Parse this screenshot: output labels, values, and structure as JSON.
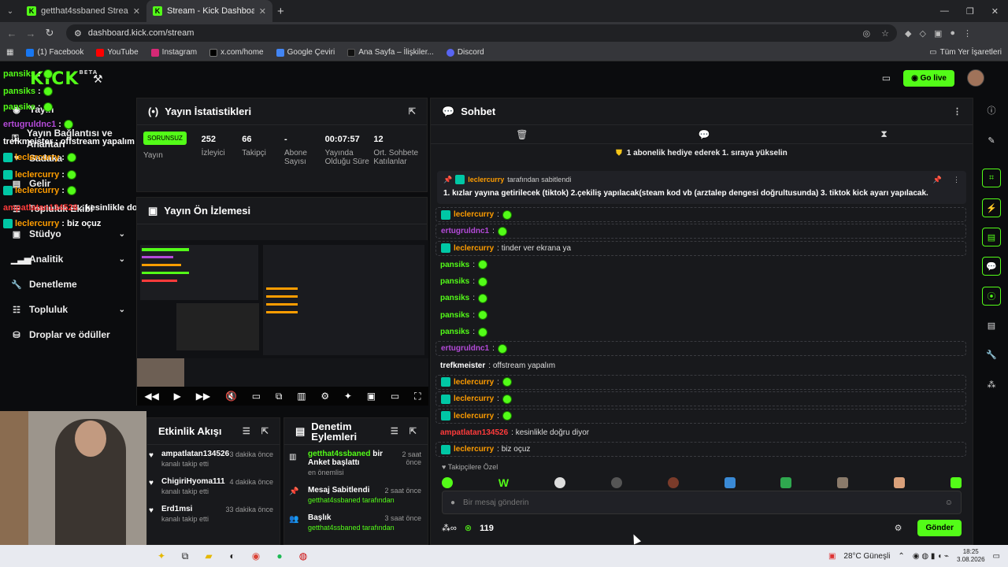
{
  "browser": {
    "tabs": [
      {
        "label": "getthat4ssbaned Stream - Watc"
      },
      {
        "label": "Stream - Kick Dashboard"
      }
    ],
    "url": "dashboard.kick.com/stream",
    "bookmarks": [
      "(1) Facebook",
      "YouTube",
      "Instagram",
      "x.com/home",
      "Google Çeviri",
      "Ana Sayfa – İlişkiler...",
      "Discord"
    ],
    "bookmarks_right": "Tüm Yer İşaretleri"
  },
  "header": {
    "logo": "KICK",
    "beta": "BETA",
    "go_live": "Go live"
  },
  "sidebar": {
    "items": [
      {
        "label": "Yayın",
        "icon": "broadcast-icon"
      },
      {
        "label": "Yayın Bağlantısı ve Anahtarı",
        "icon": "key-icon"
      },
      {
        "label": "Sadaka",
        "icon": "heart-icon"
      },
      {
        "label": "Gelir",
        "icon": "money-icon"
      },
      {
        "label": "Topluluk Ekibi",
        "icon": "team-icon"
      },
      {
        "label": "Stüdyo",
        "icon": "studio-icon"
      },
      {
        "label": "Analitik",
        "icon": "analytics-icon"
      },
      {
        "label": "Denetleme",
        "icon": "wrench-icon"
      },
      {
        "label": "Topluluk",
        "icon": "community-icon"
      },
      {
        "label": "Droplar ve ödüller",
        "icon": "drops-icon"
      }
    ]
  },
  "overlay": {
    "lines": [
      {
        "user": "pansiks",
        "text": ":"
      },
      {
        "user": "pansiks",
        "text": ":"
      },
      {
        "user": "pansiks",
        "text": ":"
      },
      {
        "user": "ertugruldnc1",
        "text": ":"
      },
      {
        "user": "trefkmeister",
        "text": ": offstream yapalım"
      },
      {
        "user": "leclercurry",
        "text": ":"
      },
      {
        "user": "leclercurry",
        "text": ":"
      },
      {
        "user": "leclercurry",
        "text": ":"
      },
      {
        "user": "ampatlatan134526",
        "text": ": kesinlikle doğru diyor"
      },
      {
        "user": "leclercurry",
        "text": ": biz oçuz"
      }
    ]
  },
  "stats": {
    "title": "Yayın İstatistikleri",
    "status": "SORUNSUZ",
    "status_label": "Yayın",
    "items": [
      {
        "value": "252",
        "label": "İzleyici"
      },
      {
        "value": "66",
        "label": "Takipçi"
      },
      {
        "value": "-",
        "label": "Abone Sayısı"
      },
      {
        "value": "00:07:57",
        "label": "Yayında Olduğu Süre"
      },
      {
        "value": "12",
        "label": "Ort. Sohbete Katılanlar"
      }
    ]
  },
  "preview": {
    "title": "Yayın Ön İzlemesi"
  },
  "activity": {
    "title": "Etkinlik Akışı",
    "items": [
      {
        "name": "ampatlatan134526",
        "sub": "kanalı takip etti",
        "time": "3 dakika önce"
      },
      {
        "name": "ChigiriHyoma111",
        "sub": "kanalı takip etti",
        "time": "4 dakika önce"
      },
      {
        "name": "Erd1msi",
        "sub": "kanalı takip etti",
        "time": "33 dakika önce"
      }
    ]
  },
  "modlog": {
    "title": "Denetim Eylemleri",
    "items": [
      {
        "name": "getthat4ssbaned",
        "action": "bir Anket başlattı",
        "sub": "en önemlisi",
        "time": "2 saat önce"
      },
      {
        "name": "Mesaj Sabitlendi",
        "action": "",
        "sub": "getthat4ssbaned tarafından",
        "time": "2 saat önce"
      },
      {
        "name": "Başlık",
        "action": "",
        "sub": "getthat4ssbaned tarafından",
        "time": "3 saat önce"
      }
    ]
  },
  "chat": {
    "title": "Sohbet",
    "sub_banner": "1 abonelik hediye ederek 1. sıraya yükselin",
    "pinned_by": "leclercurry",
    "pinned_by_suffix": "tarafından sabitlendi",
    "pinned_text": "1. kızlar yayına getirilecek (tiktok) 2.çekiliş yapılacak(steam kod vb (arztalep dengesi doğrultusunda) 3. tiktok kick ayarı yapılacak.",
    "messages": [
      {
        "user": "leclercurry",
        "text": ":",
        "color": "#ff9d00",
        "mod": true,
        "box": true,
        "emote": true
      },
      {
        "user": "ertugruldnc1",
        "text": ":",
        "color": "#b44ad9",
        "mod": false,
        "box": true,
        "emote": true
      },
      {
        "user": "leclercurry",
        "text": ": tinder ver ekrana ya",
        "color": "#ff9d00",
        "mod": true,
        "box": true,
        "emote": false
      },
      {
        "user": "pansiks",
        "text": ":",
        "color": "#53fc18",
        "mod": false,
        "box": false,
        "emote": true
      },
      {
        "user": "pansiks",
        "text": ":",
        "color": "#53fc18",
        "mod": false,
        "box": false,
        "emote": true
      },
      {
        "user": "pansiks",
        "text": ":",
        "color": "#53fc18",
        "mod": false,
        "box": false,
        "emote": true
      },
      {
        "user": "pansiks",
        "text": ":",
        "color": "#53fc18",
        "mod": false,
        "box": false,
        "emote": true
      },
      {
        "user": "pansiks",
        "text": ":",
        "color": "#53fc18",
        "mod": false,
        "box": false,
        "emote": true
      },
      {
        "user": "ertugruldnc1",
        "text": ":",
        "color": "#b44ad9",
        "mod": false,
        "box": true,
        "emote": true
      },
      {
        "user": "trefkmeister",
        "text": ": offstream yapalım",
        "color": "#ffffff",
        "mod": false,
        "box": false,
        "emote": false
      },
      {
        "user": "leclercurry",
        "text": ":",
        "color": "#ff9d00",
        "mod": true,
        "box": true,
        "emote": true
      },
      {
        "user": "leclercurry",
        "text": ":",
        "color": "#ff9d00",
        "mod": true,
        "box": true,
        "emote": true
      },
      {
        "user": "leclercurry",
        "text": ":",
        "color": "#ff9d00",
        "mod": true,
        "box": true,
        "emote": true
      },
      {
        "user": "ampatlatan134526",
        "text": ": kesinlikle doğru diyor",
        "color": "#ff3b3b",
        "mod": false,
        "box": false,
        "emote": false
      },
      {
        "user": "leclercurry",
        "text": ": biz oçuz",
        "color": "#ff9d00",
        "mod": true,
        "box": true,
        "emote": false
      }
    ],
    "followers_only": "Takipçilere Özel",
    "input_placeholder": "Bir mesaj gönderin",
    "points": "119",
    "send": "Gönder"
  },
  "taskbar": {
    "weather": "28°C Güneşli",
    "time": "18:25",
    "date": "3.08.2026"
  },
  "colors": {
    "accent": "#53fc18",
    "panel": "#18191c",
    "bg": "#0b0c0e"
  }
}
